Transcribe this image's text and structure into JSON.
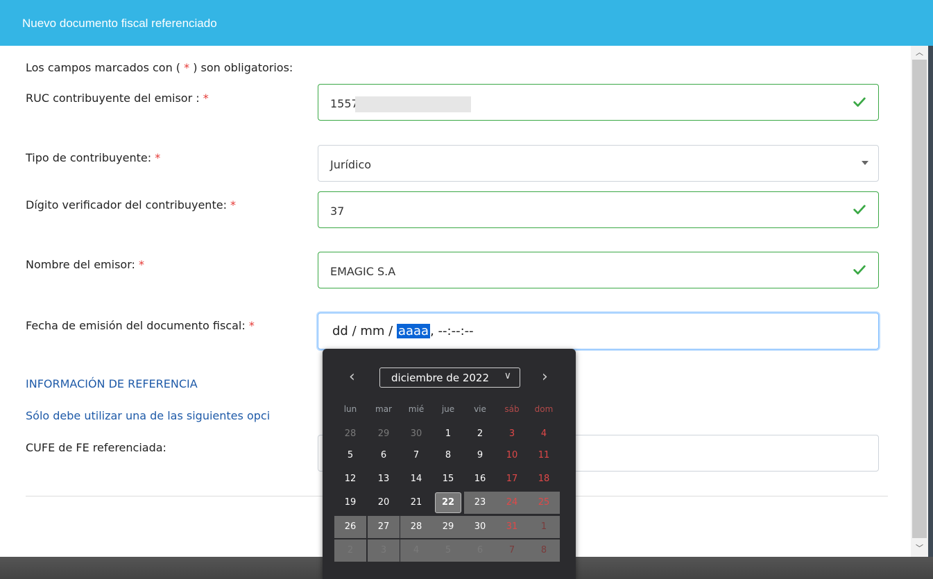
{
  "modal": {
    "title": "Nuevo documento fiscal referenciado"
  },
  "form": {
    "required_note_pre": "Los campos marcados con ( ",
    "required_note_star": "*",
    "required_note_post": " ) son obligatorios:",
    "ruc": {
      "label": "RUC contribuyente del emisor : ",
      "value": "1557"
    },
    "tipo": {
      "label": "Tipo de contribuyente: ",
      "value": "Jurídico"
    },
    "dv": {
      "label": "Dígito verificador del contribuyente: ",
      "value": "37"
    },
    "nombre": {
      "label": "Nombre del emisor: ",
      "value": "EMAGIC S.A"
    },
    "fecha": {
      "label": "Fecha de emisión del documento fiscal: ",
      "dd": "dd",
      "mm": "mm",
      "yyyy": "aaaa",
      "time": ", --:--:--",
      "sep": " / "
    },
    "required_star": "*",
    "ref_section": {
      "title": "INFORMACIÓN DE REFERENCIA",
      "subtitle": "Sólo debe utilizar una de las siguientes opci",
      "cufe_label": "CUFE de FE referenciada:"
    }
  },
  "datepicker": {
    "month_label": "diciembre de 2022",
    "prev_icon": "chevron-left-icon",
    "next_icon": "chevron-right-icon",
    "weekdays": [
      "lun",
      "mar",
      "mié",
      "jue",
      "vie",
      "sáb",
      "dom"
    ],
    "weeks": [
      [
        "28",
        "29",
        "30",
        "1",
        "2",
        "3",
        "4"
      ],
      [
        "5",
        "6",
        "7",
        "8",
        "9",
        "10",
        "11"
      ],
      [
        "12",
        "13",
        "14",
        "15",
        "16",
        "17",
        "18"
      ],
      [
        "19",
        "20",
        "21",
        "22",
        "23",
        "24",
        "25"
      ],
      [
        "26",
        "27",
        "28",
        "29",
        "30",
        "31",
        "1"
      ],
      [
        "2",
        "3",
        "4",
        "5",
        "6",
        "7",
        "8"
      ]
    ],
    "today": "22"
  },
  "colors": {
    "header": "#34b5e5",
    "valid": "#3aa845",
    "required": "#e53935",
    "section": "#1e5aa8"
  }
}
